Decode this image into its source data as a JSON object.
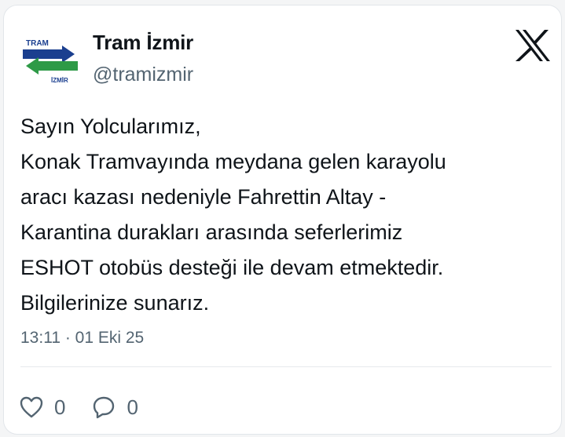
{
  "tweet": {
    "author": {
      "name": "Tram İzmir",
      "handle": "@tramizmir",
      "avatar_icon": "tram-izmir-logo",
      "avatar_text_top": "TRAM",
      "avatar_text_bottom": "İZMİR",
      "avatar_colors": {
        "blue": "#1b3f8f",
        "green": "#2e9a47"
      }
    },
    "platform_icon": "x-logo-icon",
    "text_lines": [
      "Sayın Yolcularımız,",
      "Konak Tramvayında meydana gelen karayolu",
      "aracı kazası nedeniyle Fahrettin Altay -",
      "Karantina durakları arasında seferlerimiz",
      "ESHOT otobüs desteği ile devam etmektedir.",
      "Bilgilerinize sunarız."
    ],
    "meta": "13:11 · 01 Eki 25",
    "actions": {
      "like": {
        "icon": "heart-icon",
        "count": "0"
      },
      "reply": {
        "icon": "speech-bubble-icon",
        "count": "0"
      }
    }
  }
}
